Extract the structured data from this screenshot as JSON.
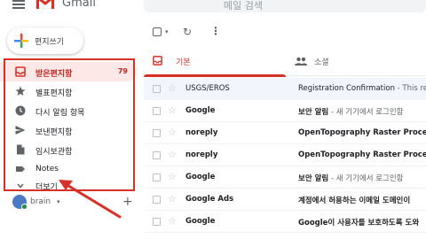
{
  "app": {
    "brand": "Gmail"
  },
  "search": {
    "placeholder": "메일 검색"
  },
  "compose": {
    "label": "편지쓰기"
  },
  "sidebar": {
    "items": [
      {
        "label": "받은편지함",
        "count": "79",
        "icon": "inbox-icon"
      },
      {
        "label": "별표편지함",
        "icon": "star-icon"
      },
      {
        "label": "다시 알림 항목",
        "icon": "clock-icon"
      },
      {
        "label": "보낸편지함",
        "icon": "send-icon"
      },
      {
        "label": "임시보관함",
        "icon": "file-icon"
      },
      {
        "label": "Notes",
        "icon": "label-icon"
      },
      {
        "label": "더보기",
        "icon": "chevron-down-icon"
      }
    ]
  },
  "account": {
    "name": "brain",
    "caret": "▾",
    "add": "+"
  },
  "toolbar": {
    "caret": "▾",
    "refresh": "↻",
    "more": "⋮"
  },
  "tabs": [
    {
      "label": "기본",
      "icon": "inbox-icon",
      "active": true
    },
    {
      "label": "소셜",
      "icon": "people-icon",
      "active": false
    }
  ],
  "emails": [
    {
      "sender": "USGS/EROS",
      "subject": "Registration Confirmation",
      "snippet": " - This rep",
      "unread": false
    },
    {
      "sender": "Google",
      "subject": "보안 알림",
      "snippet": " - 새 기기에서 로그인함 ",
      "unread": true
    },
    {
      "sender": "noreply",
      "subject": "OpenTopography Raster Processing",
      "snippet": "",
      "unread": true
    },
    {
      "sender": "noreply",
      "subject": "OpenTopography Raster Processing",
      "snippet": "",
      "unread": true
    },
    {
      "sender": "Google",
      "subject": "보안 알림",
      "snippet": " - 새 기기에서 로그인함 ",
      "unread": true
    },
    {
      "sender": "Google Ads",
      "subject": "계정에서 허용하는 이메일 도메인이",
      "snippet": "",
      "unread": true
    },
    {
      "sender": "Google",
      "subject": "Google이 사용자를 보호하도록 도와",
      "snippet": "",
      "unread": true
    }
  ],
  "colors": {
    "accent": "#d93025",
    "annotation": "#d93025"
  }
}
